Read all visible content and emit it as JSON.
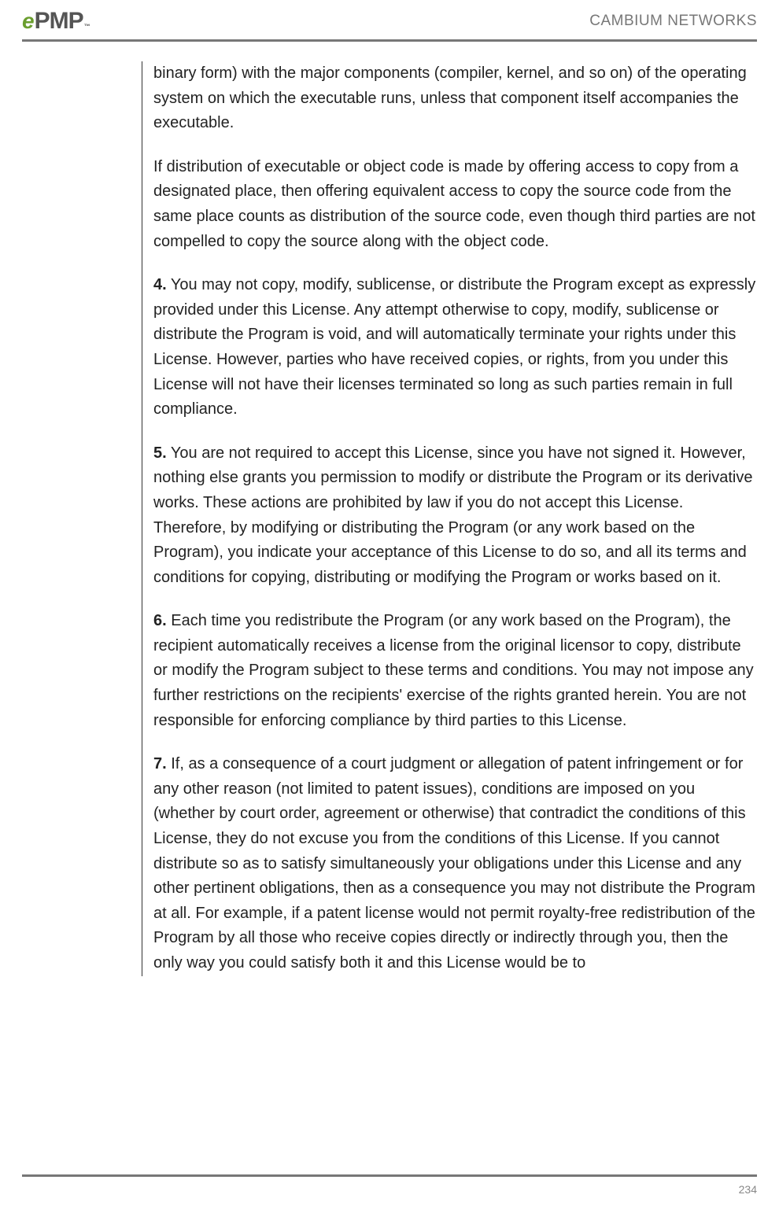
{
  "header": {
    "logo_e": "e",
    "logo_pmp": "PMP",
    "logo_tm": "™",
    "brand": "CAMBIUM NETWORKS"
  },
  "body": {
    "p1": "binary form) with the major components (compiler, kernel, and so on) of the operating system on which the executable runs, unless that component itself accompanies the executable.",
    "p2": "If distribution of executable or object code is made by offering access to copy from a designated place, then offering equivalent access to copy the source code from the same place counts as distribution of the source code, even though third parties are not compelled to copy the source along with the object code.",
    "n4": "4.",
    "p4": " You may not copy, modify, sublicense, or distribute the Program except as expressly provided under this License. Any attempt otherwise to copy, modify, sublicense or distribute the Program is void, and will automatically terminate your rights under this License. However, parties who have received copies, or rights, from you under this License will not have their licenses terminated so long as such parties remain in full compliance.",
    "n5": "5.",
    "p5": " You are not required to accept this License, since you have not signed it. However, nothing else grants you permission to modify or distribute the Program or its derivative works. These actions are prohibited by law if you do not accept this License. Therefore, by modifying or distributing the Program (or any work based on the Program), you indicate your acceptance of this License to do so, and all its terms and conditions for copying, distributing or modifying the Program or works based on it.",
    "n6": "6.",
    "p6": " Each time you redistribute the Program (or any work based on the Program), the recipient automatically receives a license from the original licensor to copy, distribute or modify the Program subject to these terms and conditions. You may not impose any further restrictions on the recipients' exercise of the rights granted herein. You are not responsible for enforcing compliance by third parties to this License.",
    "n7": "7.",
    "p7": " If, as a consequence of a court judgment or allegation of patent infringement or for any other reason (not limited to patent issues), conditions are imposed on you (whether by court order, agreement or otherwise) that contradict the conditions of this License, they do not excuse you from the conditions of this License. If you cannot distribute so as to satisfy simultaneously your obligations under this License and any other pertinent obligations, then as a consequence you may not distribute the Program at all. For example, if a patent license would not permit royalty-free redistribution of the Program by all those who receive copies directly or indirectly through you, then the only way you could satisfy both it and this License would be to"
  },
  "footer": {
    "page": "234"
  }
}
